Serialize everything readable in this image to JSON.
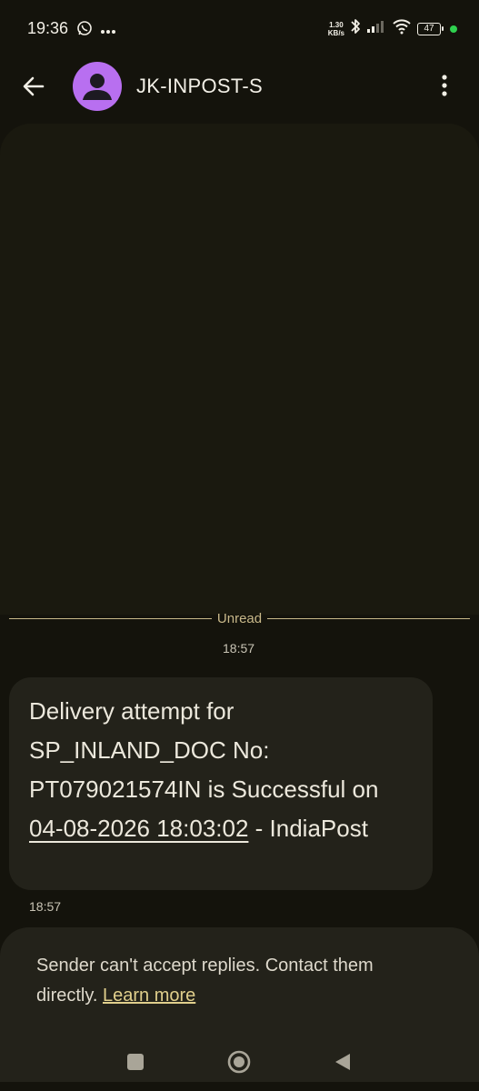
{
  "status_bar": {
    "time": "19:36",
    "net_speed_value": "1.30",
    "net_speed_unit": "KB/s",
    "battery": "47"
  },
  "header": {
    "contact_name": "JK-INPOST-S"
  },
  "conversation": {
    "unread_label": "Unread",
    "group_time": "18:57",
    "message": {
      "text_before_link": "Delivery attempt for SP_INLAND_DOC No: PT079021574IN is Successful on ",
      "link_text": "04-08-2026 18:03:02",
      "text_after_link": " - IndiaPost",
      "time": "18:57"
    }
  },
  "reply_notice": {
    "text": "Sender can't accept replies. Contact them directly. ",
    "link": "Learn more"
  },
  "colors": {
    "background": "#14130c",
    "bubble": "#23221a",
    "avatar": "#b86ff0",
    "accent_link": "#e0cf8c",
    "unread_line": "#c9b98a",
    "status_dot": "#2fd14f"
  },
  "icons": {
    "whatsapp": "whatsapp-icon",
    "bluetooth": "bluetooth-icon",
    "signal": "signal-icon",
    "wifi": "wifi-icon",
    "back": "arrow-left-icon",
    "more": "more-vertical-icon",
    "avatar": "person-icon"
  }
}
